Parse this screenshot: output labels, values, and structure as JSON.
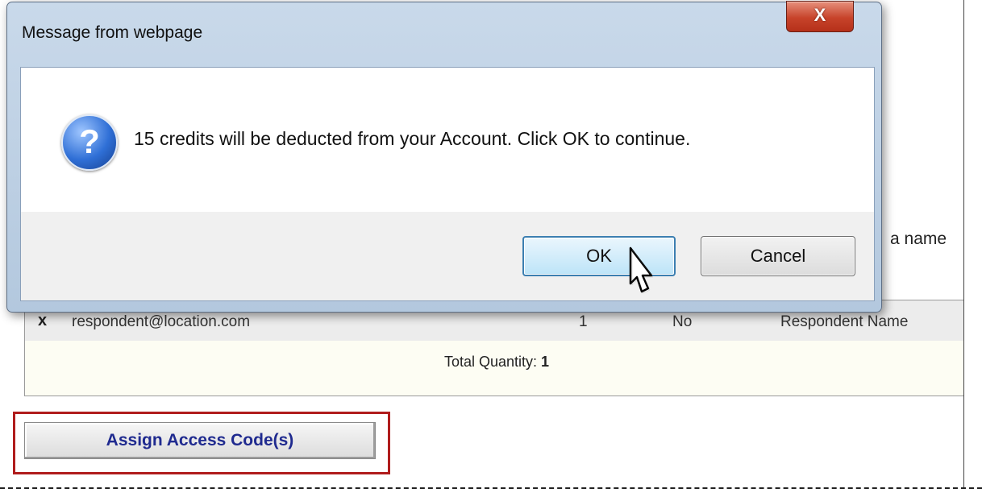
{
  "dialog": {
    "title": "Message from webpage",
    "close_label": "X",
    "icon": "question-icon",
    "icon_glyph": "?",
    "message": "15 credits will be deducted from your Account. Click OK to continue.",
    "ok_label": "OK",
    "cancel_label": "Cancel"
  },
  "page": {
    "partial_text": "a name",
    "row": {
      "remove_label": "x",
      "email": "respondent@location.com",
      "quantity": "1",
      "flag": "No",
      "name": "Respondent Name"
    },
    "total_label": "Total Quantity:",
    "total_value": "1",
    "assign_button_label": "Assign Access Code(s)"
  },
  "colors": {
    "highlight_frame": "#b01c1c",
    "assign_text": "#1f2a8f",
    "ok_border": "#3c7fb1"
  }
}
